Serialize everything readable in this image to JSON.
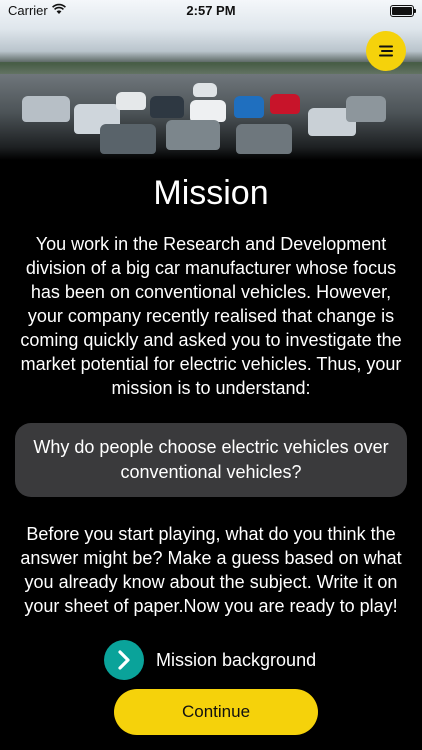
{
  "status_bar": {
    "carrier": "Carrier",
    "time": "2:57 PM"
  },
  "header": {
    "menu_icon": "menu-lines-icon"
  },
  "mission": {
    "title": "Mission",
    "intro": "You work in the Research and Development division of a big car manufacturer whose focus has been on conventional vehicles. However, your company recently realised that change is coming quickly and asked you to investigate the market potential for electric vehicles. Thus, your mission is to understand:",
    "question": "Why do people choose electric vehicles over conventional vehicles?",
    "instructions": "Before you start playing, what do you think the answer might be? Make a guess based on what you already know about the subject. Write it on your sheet of paper.Now you are ready to play!",
    "background_link_label": "Mission background",
    "continue_label": "Continue"
  },
  "colors": {
    "accent_yellow": "#f5d20b",
    "link_teal": "#0aa39a",
    "card_bg": "#3a3a3c",
    "background": "#000000"
  }
}
